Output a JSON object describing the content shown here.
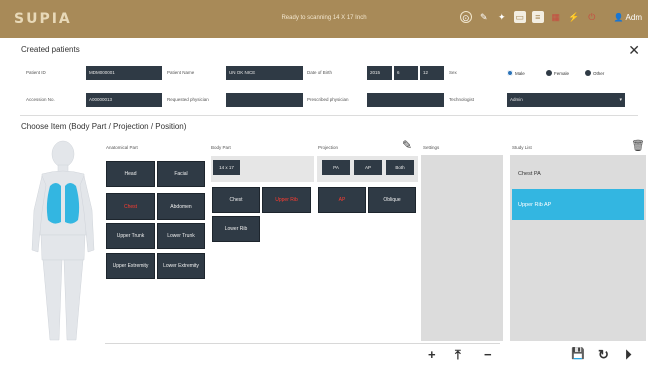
{
  "header": {
    "logo": "SUPIA",
    "status": "Ready to scanning  14 X 17 Inch",
    "user": "Adm",
    "icons": [
      "circle-icon",
      "pen-icon",
      "wand-icon",
      "monitor-icon",
      "stack-icon",
      "grid-icon",
      "plug-icon",
      "power-icon",
      "user-icon"
    ]
  },
  "patients": {
    "title": "Created patients",
    "patient_id_label": "Patient ID",
    "patient_id": "MDM000001",
    "patient_name_label": "Patient Name",
    "patient_name": "UN OK NICE",
    "dob_label": "Date of Birth",
    "dob_year": "2015",
    "dob_month": "6",
    "dob_day": "12",
    "sex_label": "Sex",
    "sex_options": [
      "Male",
      "Female",
      "Other"
    ],
    "accession_label": "Accession No.",
    "accession": "A00000013",
    "requested_label": "Requested physician",
    "requested": "",
    "prescribed_label": "Prescribed physician",
    "prescribed": "",
    "technologist_label": "Technologist",
    "technologist": "Admin"
  },
  "choose": {
    "title": "Choose Item (Body Part / Projection / Position)",
    "col_anatomical": "Anatomical Part",
    "col_body": "Body Part",
    "col_projection": "Projection",
    "col_settings": "Settings",
    "col_study": "Study List",
    "anatomical": [
      "Head",
      "Facial",
      "Chest",
      "Abdomen",
      "Upper Trunk",
      "Lower Trunk",
      "Upper Extremity",
      "Lower Extremity"
    ],
    "body_filter": "14 x 17",
    "body_parts": [
      "Chest",
      "Upper Rib",
      "Lower Rib"
    ],
    "projection_filters": [
      "PA",
      "AP",
      "Both"
    ],
    "projections": [
      "AP",
      "Oblique"
    ],
    "study_list": [
      "Chest PA",
      "Upper Rib AP"
    ]
  },
  "colors": {
    "accent": "#33b6e1",
    "header": "#a88a58",
    "button": "#2f3a45",
    "selected_text": "#ff3b30"
  }
}
